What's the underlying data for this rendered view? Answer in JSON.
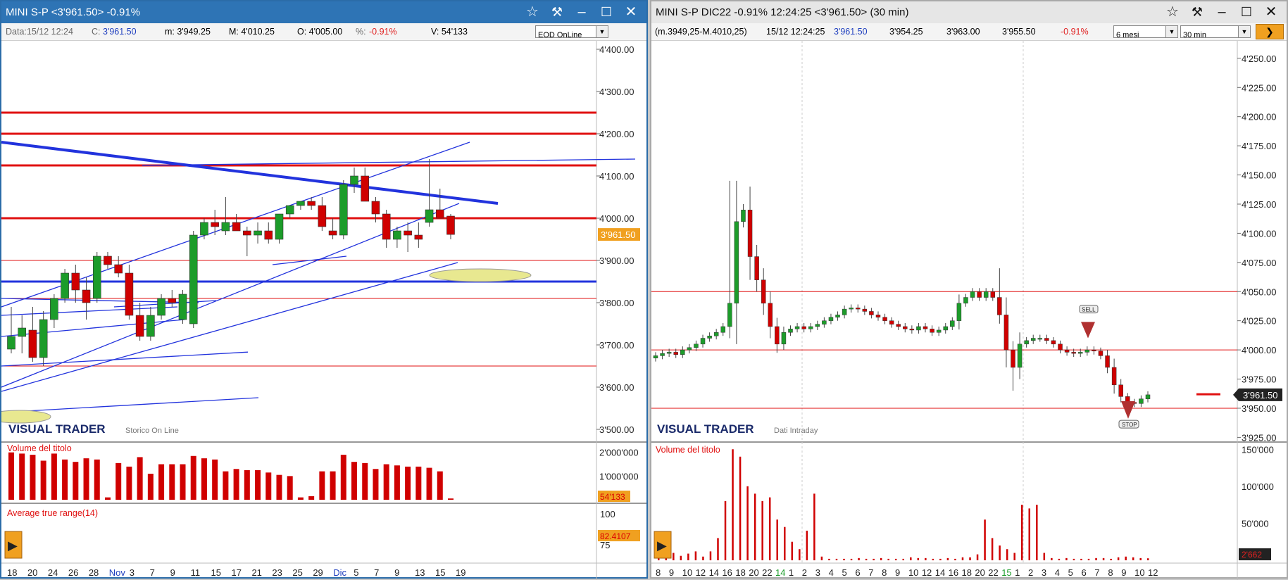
{
  "left": {
    "title": "MINI S-P <3'961.50> -0.91%",
    "info": {
      "data": "Data:15/12 12:24",
      "c_lbl": "C:",
      "c": "3'961.50",
      "m": "m: 3'949.25",
      "M": "M: 4'010.25",
      "o": "O: 4'005.00",
      "pct_lbl": "%:",
      "pct": "-0.91%",
      "v": "V: 54'133"
    },
    "mode": "EOD OnLine",
    "brand": "VISUAL TRADER",
    "brand_sub": "Storico On Line",
    "price_badge": "3'961.50",
    "vol_title": "Volume del titolo",
    "vol_badge": "54'133",
    "atr_title": "Average true range(14)",
    "atr_badge": "82.4107",
    "atr_ticks": [
      "100",
      "75"
    ],
    "price_ticks": [
      "4'400.00",
      "4'300.00",
      "4'200.00",
      "4'100.00",
      "4'000.00",
      "3'900.00",
      "3'800.00",
      "3'700.00",
      "3'600.00",
      "3'500.00"
    ],
    "vol_ticks": [
      "2'000'000",
      "1'000'000"
    ],
    "xlabels": [
      "18",
      "20",
      "24",
      "26",
      "28",
      "Nov",
      "3",
      "7",
      "9",
      "11",
      "15",
      "17",
      "21",
      "23",
      "25",
      "29",
      "Dic",
      "5",
      "7",
      "9",
      "13",
      "15",
      "19"
    ]
  },
  "right": {
    "title": "MINI S-P DIC22 -0.91% 12:24:25  <3'961.50>  (30 min)",
    "info": {
      "range": "(m.3949,25-M.4010,25)",
      "time": "15/12 12:24:25",
      "last": "3'961.50",
      "o": "3'954.25",
      "h": "3'963.00",
      "l": "3'955.50",
      "pct": "-0.91%"
    },
    "period": "6 mesi",
    "interval": "30 min",
    "brand": "VISUAL TRADER",
    "brand_sub": "Dati Intraday",
    "price_badge": "3'961.50",
    "sell": "SELL",
    "stop": "STOP",
    "vol_title": "Volume del titolo",
    "vol_badge": "2'662",
    "price_ticks": [
      "4'250.00",
      "4'225.00",
      "4'200.00",
      "4'175.00",
      "4'150.00",
      "4'125.00",
      "4'100.00",
      "4'075.00",
      "4'050.00",
      "4'025.00",
      "4'000.00",
      "3'975.00",
      "3'950.00",
      "3'925.00"
    ],
    "vol_ticks": [
      "150'000",
      "100'000",
      "50'000"
    ],
    "xlabels": [
      "8",
      "9",
      "10",
      "12",
      "14",
      "16",
      "18",
      "20",
      "22",
      "14",
      "1",
      "2",
      "3",
      "4",
      "5",
      "6",
      "7",
      "8",
      "9",
      "10",
      "12",
      "14",
      "16",
      "18",
      "20",
      "22",
      "15",
      "1",
      "2",
      "3",
      "4",
      "5",
      "6",
      "7",
      "8",
      "9",
      "10",
      "12"
    ]
  },
  "colors": {
    "up": "#1c9c2a",
    "down": "#d00000",
    "res": "#e01010",
    "trend": "#2233dd",
    "badge": "#f0a020"
  },
  "chart_data": [
    {
      "type": "candlestick",
      "title": "MINI S-P",
      "ylim": [
        3470,
        4420
      ],
      "x": [
        "Oct 18",
        "Oct 19",
        "Oct 20",
        "Oct 21",
        "Oct 24",
        "Oct 25",
        "Oct 26",
        "Oct 27",
        "Oct 28",
        "Oct 31",
        "Nov 1",
        "Nov 2",
        "Nov 3",
        "Nov 4",
        "Nov 7",
        "Nov 8",
        "Nov 9",
        "Nov 10",
        "Nov 11",
        "Nov 14",
        "Nov 15",
        "Nov 16",
        "Nov 17",
        "Nov 18",
        "Nov 21",
        "Nov 22",
        "Nov 23",
        "Nov 25",
        "Nov 28",
        "Nov 29",
        "Nov 30",
        "Dec 1",
        "Dec 2",
        "Dec 5",
        "Dec 6",
        "Dec 7",
        "Dec 8",
        "Dec 9",
        "Dec 12",
        "Dec 13",
        "Dec 14",
        "Dec 15"
      ],
      "ohlc": [
        [
          3690,
          3790,
          3680,
          3720
        ],
        [
          3720,
          3770,
          3680,
          3740
        ],
        [
          3735,
          3790,
          3660,
          3670
        ],
        [
          3670,
          3780,
          3650,
          3760
        ],
        [
          3760,
          3820,
          3740,
          3810
        ],
        [
          3810,
          3880,
          3800,
          3870
        ],
        [
          3870,
          3890,
          3800,
          3830
        ],
        [
          3830,
          3860,
          3760,
          3800
        ],
        [
          3810,
          3920,
          3800,
          3910
        ],
        [
          3910,
          3920,
          3880,
          3890
        ],
        [
          3890,
          3910,
          3860,
          3870
        ],
        [
          3870,
          3890,
          3760,
          3770
        ],
        [
          3770,
          3800,
          3710,
          3720
        ],
        [
          3720,
          3790,
          3710,
          3770
        ],
        [
          3770,
          3820,
          3760,
          3810
        ],
        [
          3810,
          3830,
          3790,
          3800
        ],
        [
          3760,
          3830,
          3750,
          3820
        ],
        [
          3750,
          3970,
          3740,
          3960
        ],
        [
          3960,
          4000,
          3950,
          3990
        ],
        [
          3990,
          4020,
          3960,
          3980
        ],
        [
          3970,
          4050,
          3960,
          3990
        ],
        [
          3990,
          4010,
          3970,
          3970
        ],
        [
          3970,
          3980,
          3910,
          3960
        ],
        [
          3960,
          3990,
          3940,
          3970
        ],
        [
          3970,
          3990,
          3940,
          3950
        ],
        [
          3950,
          4010,
          3940,
          4010
        ],
        [
          4010,
          4030,
          4000,
          4030
        ],
        [
          4030,
          4040,
          4020,
          4040
        ],
        [
          4040,
          4050,
          4020,
          4030
        ],
        [
          4030,
          4050,
          3970,
          3980
        ],
        [
          3970,
          4000,
          3950,
          3960
        ],
        [
          3960,
          4090,
          3950,
          4080
        ],
        [
          4080,
          4120,
          4060,
          4100
        ],
        [
          4100,
          4120,
          4060,
          4040
        ],
        [
          4040,
          4050,
          3990,
          4010
        ],
        [
          4010,
          4020,
          3930,
          3950
        ],
        [
          3950,
          3980,
          3930,
          3970
        ],
        [
          3970,
          3990,
          3920,
          3960
        ],
        [
          3960,
          3990,
          3930,
          3950
        ],
        [
          3990,
          4140,
          3980,
          4020
        ],
        [
          4020,
          4070,
          4000,
          4000
        ],
        [
          4005,
          4010,
          3950,
          3961.5
        ]
      ],
      "volume_series": [
        2000000,
        1950000,
        1900000,
        1650000,
        1950000,
        1700000,
        1600000,
        1750000,
        1700000,
        100000,
        1550000,
        1400000,
        1800000,
        1100000,
        1500000,
        1500000,
        1500000,
        1850000,
        1750000,
        1700000,
        1200000,
        1300000,
        1250000,
        1250000,
        1150000,
        1050000,
        1000000,
        100000,
        150000,
        1200000,
        1200000,
        1900000,
        1600000,
        1550000,
        1300000,
        1500000,
        1450000,
        1400000,
        1400000,
        1350000,
        1200000,
        54133
      ],
      "atr": [
        {
          "x": "Dec 15",
          "value": 82.4107
        }
      ],
      "horizontal_lines": [
        4250,
        4200,
        4125,
        4000,
        3900,
        3850,
        3810,
        3650
      ]
    },
    {
      "type": "candlestick",
      "title": "MINI S-P DIC22 (30 min)",
      "ylim": [
        3921,
        4265
      ],
      "resistance": [
        4050,
        4000,
        3950
      ],
      "signals": [
        {
          "label": "SELL",
          "price": 4015
        },
        {
          "label": "STOP",
          "price": 3945
        }
      ],
      "close_path": [
        3995,
        3997,
        3998,
        3996,
        4000,
        4002,
        4005,
        4010,
        4012,
        4015,
        4020,
        4040,
        4110,
        4120,
        4080,
        4060,
        4040,
        4020,
        4005,
        4015,
        4018,
        4020,
        4018,
        4020,
        4022,
        4025,
        4028,
        4030,
        4035,
        4036,
        4035,
        4033,
        4030,
        4028,
        4025,
        4022,
        4020,
        4018,
        4017,
        4020,
        4018,
        4015,
        4017,
        4020,
        4025,
        4040,
        4045,
        4050,
        4045,
        4050,
        4045,
        4030,
        4000,
        3985,
        4005,
        4008,
        4010,
        4010,
        4008,
        4005,
        4000,
        3998,
        3997,
        3998,
        4000,
        3999,
        3995,
        3985,
        3970,
        3960,
        3955,
        3954,
        3958,
        3961.5
      ],
      "volume_series": [
        5000,
        8000,
        10000,
        6000,
        9000,
        12000,
        5000,
        12000,
        30000,
        80000,
        150000,
        140000,
        100000,
        90000,
        80000,
        85000,
        55000,
        45000,
        25000,
        15000,
        40000,
        90000,
        5000,
        2000,
        2000,
        2000,
        2000,
        3000,
        2000,
        2000,
        3000,
        2000,
        2000,
        2000,
        4000,
        3000,
        3000,
        2000,
        2000,
        3000,
        2000,
        4000,
        4000,
        8000,
        55000,
        30000,
        20000,
        15000,
        10000,
        75000,
        70000,
        75000,
        10000,
        3000,
        2000,
        3000,
        2000,
        2000,
        2000,
        3000,
        3000,
        2000,
        4000,
        5000,
        4000,
        3000,
        2662
      ]
    }
  ]
}
